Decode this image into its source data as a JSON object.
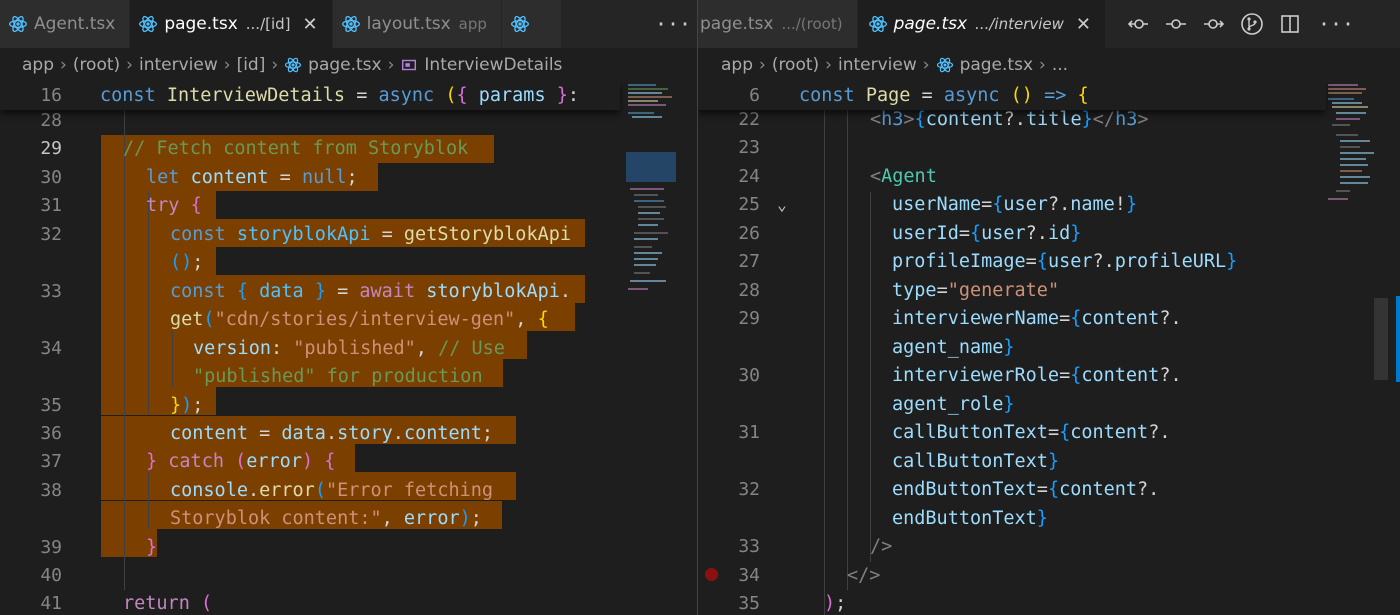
{
  "left_pane": {
    "tabs": [
      {
        "name": "Agent.tsx",
        "desc": "",
        "active": false
      },
      {
        "name": "page.tsx",
        "desc": ".../[id]",
        "active": true
      },
      {
        "name": "layout.tsx",
        "desc": "app",
        "active": false
      }
    ],
    "more_label": "···",
    "breadcrumb": [
      "app",
      "(root)",
      "interview",
      "[id]",
      "page.tsx",
      "InterviewDetails"
    ]
  },
  "right_pane": {
    "tabs": [
      {
        "name": "page.tsx",
        "desc": ".../(root)",
        "active": false
      },
      {
        "name": "page.tsx",
        "desc": ".../interview",
        "active": true
      }
    ],
    "close_label": "✕",
    "breadcrumb": [
      "app",
      "(root)",
      "interview",
      "page.tsx",
      "..."
    ]
  },
  "left_code": {
    "sticky": {
      "num": "16",
      "text": "const InterviewDetails = async ({ params }:"
    },
    "lines": [
      {
        "num": "28",
        "text": ""
      },
      {
        "num": "29",
        "text": "// Fetch content from Storyblok"
      },
      {
        "num": "30",
        "text": "let content = null;"
      },
      {
        "num": "31",
        "text": "try {"
      },
      {
        "num": "32",
        "text": "const storyblokApi = getStoryblokApi"
      },
      {
        "num": "",
        "text": "();"
      },
      {
        "num": "33",
        "text": "const { data } = await storyblokApi."
      },
      {
        "num": "",
        "text": "get(\"cdn/stories/interview-gen\", {"
      },
      {
        "num": "34",
        "text": "version: \"published\", // Use"
      },
      {
        "num": "",
        "text": "\"published\" for production"
      },
      {
        "num": "35",
        "text": "});"
      },
      {
        "num": "36",
        "text": "content = data.story.content;"
      },
      {
        "num": "37",
        "text": "} catch (error) {"
      },
      {
        "num": "38",
        "text": "console.error(\"Error fetching"
      },
      {
        "num": "",
        "text": "Storyblok content:\", error);"
      },
      {
        "num": "39",
        "text": "}"
      },
      {
        "num": "40",
        "text": ""
      },
      {
        "num": "41",
        "text": "return ("
      }
    ]
  },
  "right_code": {
    "sticky": {
      "num": "6",
      "text": "const Page = async () => {"
    },
    "lines": [
      {
        "num": "22",
        "text": "<h3>{content?.title}</h3>"
      },
      {
        "num": "23",
        "text": ""
      },
      {
        "num": "24",
        "text": "<Agent"
      },
      {
        "num": "25",
        "text": "userName={user?.name!}"
      },
      {
        "num": "26",
        "text": "userId={user?.id}"
      },
      {
        "num": "27",
        "text": "profileImage={user?.profileURL}"
      },
      {
        "num": "28",
        "text": "type=\"generate\""
      },
      {
        "num": "29",
        "text": "interviewerName={content?."
      },
      {
        "num": "",
        "text": "agent_name}"
      },
      {
        "num": "30",
        "text": "interviewerRole={content?."
      },
      {
        "num": "",
        "text": "agent_role}"
      },
      {
        "num": "31",
        "text": "callButtonText={content?."
      },
      {
        "num": "",
        "text": "callButtonText}"
      },
      {
        "num": "32",
        "text": "endButtonText={content?."
      },
      {
        "num": "",
        "text": "endButtonText}"
      },
      {
        "num": "33",
        "text": "/>"
      },
      {
        "num": "34",
        "text": "</>"
      },
      {
        "num": "35",
        "text": ");"
      }
    ]
  },
  "colors": {
    "editor_bg": "#1e1e1e",
    "selection_highlight": "#7b3f00",
    "keyword": "#569cd6",
    "function": "#dcdcaa",
    "string": "#ce9178",
    "comment": "#6a9955",
    "react_icon": "#4fc1ff",
    "breakpoint": "#8b1111"
  },
  "icons": [
    "react-icon",
    "more-icon",
    "close-icon",
    "go-back-icon",
    "git-commit-icon",
    "go-forward-icon",
    "git-branch-icon",
    "split-editor-icon",
    "symbol-class-icon",
    "fold-chevron-icon",
    "breakpoint-icon"
  ]
}
